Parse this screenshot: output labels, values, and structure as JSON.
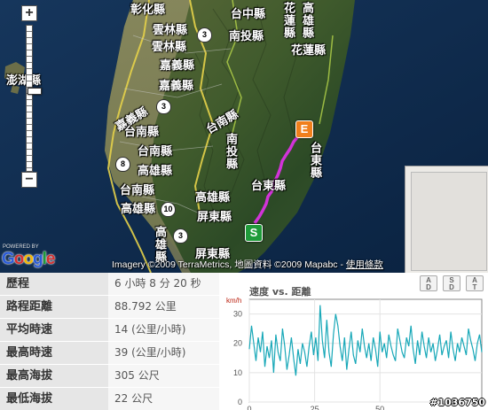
{
  "map": {
    "labels": {
      "changhua": "彰化縣",
      "taichung_city": "台中縣",
      "yunlin": "雲林縣",
      "yunlin2": "雲林縣",
      "chiayi": "嘉義縣",
      "chiayi2": "嘉義縣",
      "chiayi_city": "嘉義縣",
      "tainan": "台南縣",
      "tainan2": "台南縣",
      "tainan3": "台南縣",
      "kaohsiung": "高雄縣",
      "kaohsiung2": "高雄縣",
      "kaohsiung3": "高雄縣",
      "kaohsiung4": "高雄縣",
      "nantou": "南投縣",
      "nantou2": "南投縣",
      "hualien": "花蓮縣",
      "hualien2": "花蓮縣",
      "taitung": "台東縣",
      "taitung2": "台東縣",
      "pingtung": "屏東縣",
      "pingtung2": "屏東縣",
      "penghu": "澎湖縣"
    },
    "shields": {
      "r3": "3",
      "r3b": "3",
      "r8": "8",
      "r10": "10",
      "r3c": "3"
    },
    "zoom_in": "+",
    "zoom_out": "−",
    "marker_start": "S",
    "marker_end": "E",
    "powered_by": "POWERED BY",
    "google": [
      "G",
      "o",
      "o",
      "g",
      "l",
      "e"
    ],
    "copyright_text": "Imagery ©2009 TerraMetrics, 地圖資料 ©2009 Mapabc - ",
    "terms_link": "使用條款",
    "zoom_level_fraction": 0.56
  },
  "stats": [
    {
      "label": "歷程",
      "value": "6 小時 8 分 20 秒"
    },
    {
      "label": "路程距離",
      "value": "88.792 公里"
    },
    {
      "label": "平均時速",
      "value": "14 (公里/小時)"
    },
    {
      "label": "最高時速",
      "value": "39 (公里/小時)"
    },
    {
      "label": "最高海拔",
      "value": "305 公尺"
    },
    {
      "label": "最低海拔",
      "value": "22 公尺"
    }
  ],
  "chart_buttons": [
    {
      "top": "A",
      "bottom": "D"
    },
    {
      "top": "S",
      "bottom": "D"
    },
    {
      "top": "A",
      "bottom": "T"
    }
  ],
  "chart_data": {
    "type": "line",
    "title": "速度 vs. 距離",
    "ylabel": "km/h",
    "xlabel": "",
    "xlim": [
      0,
      89
    ],
    "ylim": [
      0,
      35
    ],
    "xticks": [
      0,
      25,
      50
    ],
    "yticks": [
      0,
      10,
      20,
      30
    ],
    "grid": true,
    "color": "#18a8b8",
    "y": [
      18,
      26,
      20,
      14,
      22,
      17,
      24,
      12,
      19,
      15,
      21,
      10,
      23,
      17,
      14,
      25,
      19,
      11,
      16,
      22,
      15,
      9,
      18,
      13,
      20,
      17,
      12,
      19,
      24,
      16,
      22,
      14,
      33,
      21,
      15,
      28,
      17,
      12,
      23,
      30,
      26,
      19,
      14,
      22,
      11,
      18,
      24,
      16,
      13,
      21,
      17,
      25,
      19,
      15,
      20,
      14,
      22,
      18,
      12,
      24,
      17,
      20,
      15,
      23,
      19,
      16,
      14,
      25,
      21,
      17,
      15,
      22,
      19,
      26,
      18,
      13,
      21,
      16,
      24,
      19,
      15,
      22,
      17,
      20,
      14,
      18,
      23,
      16,
      19,
      21,
      15,
      24,
      18,
      14,
      20,
      17,
      22,
      19,
      16,
      25,
      21,
      18,
      14,
      20,
      23,
      17
    ]
  },
  "watermark": "#1036750"
}
